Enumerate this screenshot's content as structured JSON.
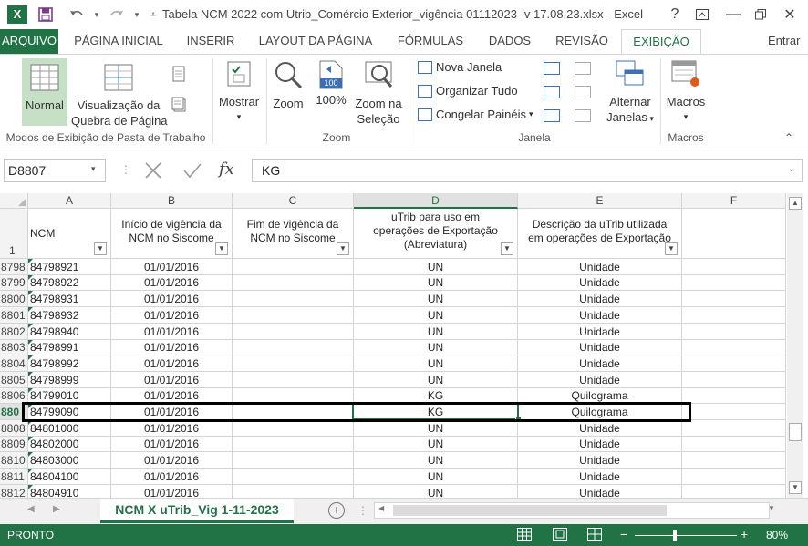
{
  "title_bar": {
    "app_icon": "X",
    "title": "Tabela NCM 2022 com Utrib_Comércio Exterior_vigência  01112023- v 17.08.23.xlsx - Excel",
    "help": "?",
    "min": "—",
    "close": "✕"
  },
  "tabs": {
    "file": "ARQUIVO",
    "home": "PÁGINA INICIAL",
    "insert": "INSERIR",
    "layout": "LAYOUT DA PÁGINA",
    "formulas": "FÓRMULAS",
    "data": "DADOS",
    "review": "REVISÃO",
    "view": "EXIBIÇÃO",
    "signin": "Entrar"
  },
  "ribbon": {
    "normal": "Normal",
    "page_break_1": "Visualização da",
    "page_break_2": "Quebra de Página",
    "group_workbook_views": "Modos de Exibição de Pasta de Trabalho",
    "show": "Mostrar",
    "zoom": "Zoom",
    "zoom100": "100%",
    "zoom_sel_1": "Zoom na",
    "zoom_sel_2": "Seleção",
    "group_zoom": "Zoom",
    "new_window": "Nova Janela",
    "arrange_all": "Organizar Tudo",
    "freeze_panes": "Congelar Painéis",
    "switch_1": "Alternar",
    "switch_2": "Janelas",
    "group_window": "Janela",
    "macros": "Macros",
    "group_macros": "Macros",
    "icon_100": "100"
  },
  "formula_bar": {
    "name_box": "D8807",
    "fx": "fx",
    "value": "KG"
  },
  "grid": {
    "columns": [
      "A",
      "B",
      "C",
      "D",
      "E",
      "F"
    ],
    "header_row_num": "1",
    "headers": {
      "a": "NCM",
      "b1": "Início de vigência da",
      "b2": "NCM  no Siscome",
      "c1": "Fim de vigência da",
      "c2": "NCM no Siscome",
      "d1": "uTrib para uso em",
      "d2": "operações de Exportação",
      "d3": "(Abreviatura)",
      "e1": "Descrição da uTrib utilizada",
      "e2": "em operações de Exportação"
    },
    "rows": [
      {
        "num": "8798",
        "ncm": "84798921",
        "inicio": "01/01/2016",
        "fim": "",
        "utrib": "UN",
        "desc": "Unidade"
      },
      {
        "num": "8799",
        "ncm": "84798922",
        "inicio": "01/01/2016",
        "fim": "",
        "utrib": "UN",
        "desc": "Unidade"
      },
      {
        "num": "8800",
        "ncm": "84798931",
        "inicio": "01/01/2016",
        "fim": "",
        "utrib": "UN",
        "desc": "Unidade"
      },
      {
        "num": "8801",
        "ncm": "84798932",
        "inicio": "01/01/2016",
        "fim": "",
        "utrib": "UN",
        "desc": "Unidade"
      },
      {
        "num": "8802",
        "ncm": "84798940",
        "inicio": "01/01/2016",
        "fim": "",
        "utrib": "UN",
        "desc": "Unidade"
      },
      {
        "num": "8803",
        "ncm": "84798991",
        "inicio": "01/01/2016",
        "fim": "",
        "utrib": "UN",
        "desc": "Unidade"
      },
      {
        "num": "8804",
        "ncm": "84798992",
        "inicio": "01/01/2016",
        "fim": "",
        "utrib": "UN",
        "desc": "Unidade"
      },
      {
        "num": "8805",
        "ncm": "84798999",
        "inicio": "01/01/2016",
        "fim": "",
        "utrib": "UN",
        "desc": "Unidade"
      },
      {
        "num": "8806",
        "ncm": "84799010",
        "inicio": "01/01/2016",
        "fim": "",
        "utrib": "KG",
        "desc": "Quilograma"
      },
      {
        "num": "880",
        "ncm": "84799090",
        "inicio": "01/01/2016",
        "fim": "",
        "utrib": "KG",
        "desc": "Quilograma",
        "selected": true
      },
      {
        "num": "8808",
        "ncm": "84801000",
        "inicio": "01/01/2016",
        "fim": "",
        "utrib": "UN",
        "desc": "Unidade"
      },
      {
        "num": "8809",
        "ncm": "84802000",
        "inicio": "01/01/2016",
        "fim": "",
        "utrib": "UN",
        "desc": "Unidade"
      },
      {
        "num": "8810",
        "ncm": "84803000",
        "inicio": "01/01/2016",
        "fim": "",
        "utrib": "UN",
        "desc": "Unidade"
      },
      {
        "num": "8811",
        "ncm": "84804100",
        "inicio": "01/01/2016",
        "fim": "",
        "utrib": "UN",
        "desc": "Unidade"
      },
      {
        "num": "8812",
        "ncm": "84804910",
        "inicio": "01/01/2016",
        "fim": "",
        "utrib": "UN",
        "desc": "Unidade"
      }
    ]
  },
  "sheet": {
    "tab": "NCM X uTrib_Vig 1-11-2023",
    "add": "+"
  },
  "status": {
    "ready": "PRONTO",
    "minus": "−",
    "plus": "+",
    "zoom": "80%"
  }
}
